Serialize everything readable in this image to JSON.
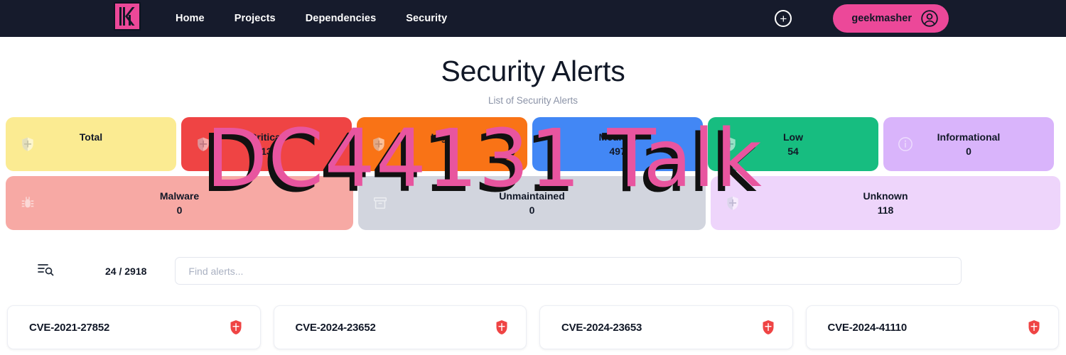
{
  "navbar": {
    "logo_name": "kraken-logo",
    "links": [
      {
        "label": "Home",
        "name": "nav-link-home"
      },
      {
        "label": "Projects",
        "name": "nav-link-projects"
      },
      {
        "label": "Dependencies",
        "name": "nav-link-dependencies"
      },
      {
        "label": "Security",
        "name": "nav-link-security"
      }
    ],
    "add_button_label": "+",
    "user": "geekmasher",
    "background": "#161b2c",
    "accent": "#ec4899"
  },
  "header": {
    "title": "Security Alerts",
    "subtitle": "List of Security Alerts"
  },
  "stats": {
    "row1": [
      {
        "label": "Total",
        "value": "",
        "bg": "#fbeb92",
        "icon": "shield-icon",
        "flex": "0 0 240px"
      },
      {
        "label": "Critical",
        "value": "13",
        "bg": "#ef4444",
        "icon": "shield-icon",
        "flex": "0 0 240px"
      },
      {
        "label": "High",
        "value": "",
        "bg": "#f97316",
        "icon": "shield-icon",
        "flex": "0 0 240px"
      },
      {
        "label": "Medium",
        "value": "497",
        "bg": "#4287f5",
        "icon": "shield-icon",
        "flex": "0 0 240px"
      },
      {
        "label": "Low",
        "value": "54",
        "bg": "#17bd80",
        "icon": "shield-icon",
        "flex": "0 0 240px"
      },
      {
        "label": "Informational",
        "value": "0",
        "bg": "#d9b4fb",
        "icon": "info-icon",
        "flex": "0 0 240px"
      }
    ],
    "row2": [
      {
        "label": "Malware",
        "value": "0",
        "bg": "#f7a9a4",
        "icon": "bug-icon",
        "flex": "0 0 489px"
      },
      {
        "label": "Unmaintained",
        "value": "0",
        "bg": "#d2d5de",
        "icon": "archive-icon",
        "flex": "0 0 489px"
      },
      {
        "label": "Unknown",
        "value": "118",
        "bg": "#eed5fb",
        "icon": "shield-icon",
        "flex": "1 1 0"
      }
    ]
  },
  "toolbar": {
    "filter_icon": "filter-search-icon",
    "count": "24  /  2918",
    "search_placeholder": "Find alerts...",
    "search_value": ""
  },
  "alerts": [
    {
      "id": "CVE-2021-27852",
      "severity_icon": "shield-critical-icon",
      "severity_color": "#ef4444"
    },
    {
      "id": "CVE-2024-23652",
      "severity_icon": "shield-critical-icon",
      "severity_color": "#ef4444"
    },
    {
      "id": "CVE-2024-23653",
      "severity_icon": "shield-critical-icon",
      "severity_color": "#ef4444"
    },
    {
      "id": "CVE-2024-41110",
      "severity_icon": "shield-critical-icon",
      "severity_color": "#ef4444"
    }
  ],
  "watermark": {
    "text": "DC44131 Talk",
    "color": "#e8559f",
    "shadow": "#111111"
  }
}
